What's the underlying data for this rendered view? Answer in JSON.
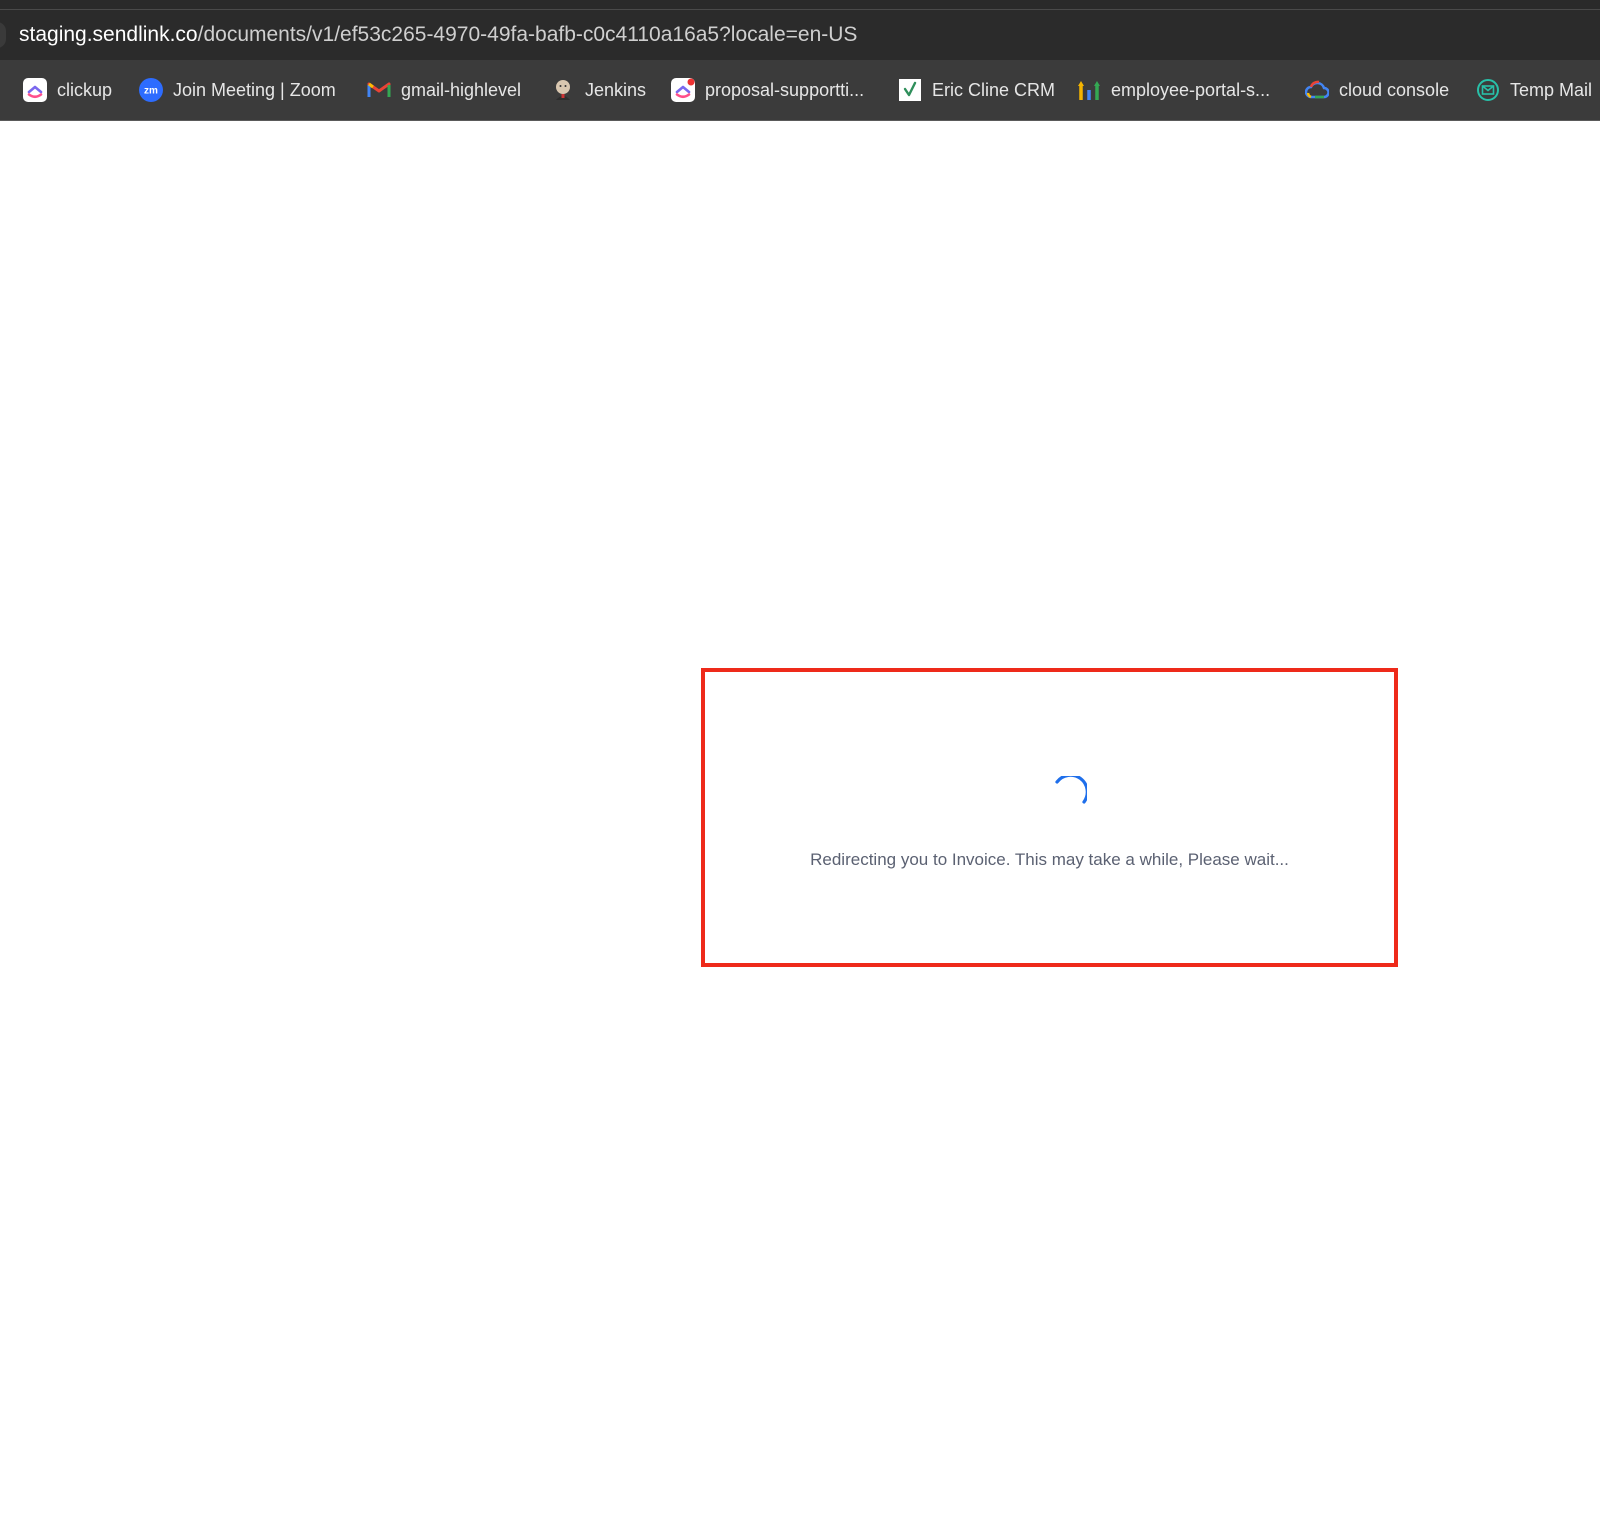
{
  "browser": {
    "url_host": "staging.sendlink.co",
    "url_path": "/documents/v1/ef53c265-4970-49fa-bafb-c0c4110a16a5?locale=en-US",
    "bookmarks": [
      {
        "label": "clickup",
        "icon": "clickup-icon"
      },
      {
        "label": "Join Meeting | Zoom",
        "icon": "zoom-icon"
      },
      {
        "label": "gmail-highlevel",
        "icon": "gmail-icon"
      },
      {
        "label": "Jenkins",
        "icon": "jenkins-icon"
      },
      {
        "label": "proposal-supportti...",
        "icon": "clickup-icon"
      },
      {
        "label": "Eric Cline CRM",
        "icon": "crm-icon"
      },
      {
        "label": "employee-portal-s...",
        "icon": "analytics-icon"
      },
      {
        "label": "cloud console",
        "icon": "google-cloud-icon"
      },
      {
        "label": "Temp Mail",
        "icon": "temp-mail-icon"
      }
    ]
  },
  "page": {
    "loading_message": "Redirecting you to Invoice. This may take a while, Please wait...",
    "spinner_color": "#1f6feb",
    "highlight_color": "#ee2a1a"
  }
}
